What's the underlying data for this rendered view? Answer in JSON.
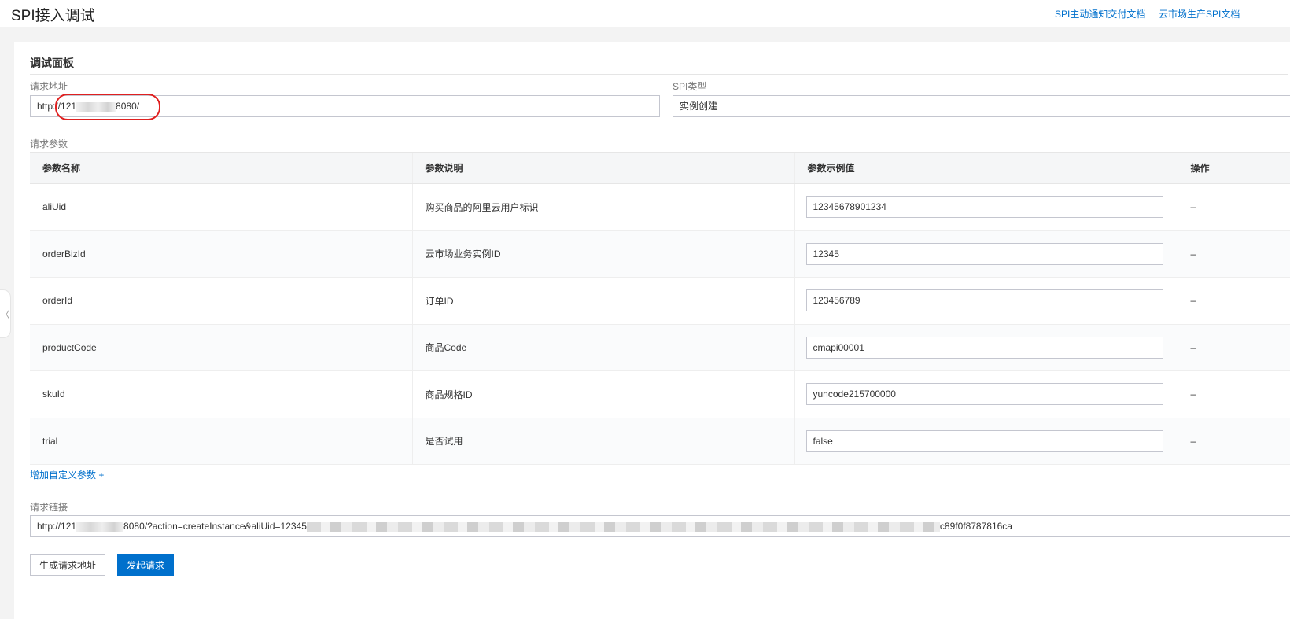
{
  "header": {
    "title": "SPI接入调试",
    "links": [
      "SPI主动通知交付文档",
      "云市场生产SPI文档"
    ]
  },
  "side_handle": {
    "glyph": "〈"
  },
  "panel": {
    "title": "调试面板",
    "request_address": {
      "label": "请求地址",
      "value_prefix": "http://121",
      "value_suffix": "8080/"
    },
    "spi_type": {
      "label": "SPI类型",
      "value": "实例创建"
    },
    "params": {
      "label": "请求参数",
      "columns": [
        "参数名称",
        "参数说明",
        "参数示例值",
        "操作"
      ],
      "rows": [
        {
          "name": "aliUid",
          "desc": "购买商品的阿里云用户标识",
          "value": "12345678901234",
          "action": "–"
        },
        {
          "name": "orderBizId",
          "desc": "云市场业务实例ID",
          "value": "12345",
          "action": "–"
        },
        {
          "name": "orderId",
          "desc": "订单ID",
          "value": "123456789",
          "action": "–"
        },
        {
          "name": "productCode",
          "desc": "商品Code",
          "value": "cmapi00001",
          "action": "–"
        },
        {
          "name": "skuId",
          "desc": "商品规格ID",
          "value": "yuncode215700000",
          "action": "–"
        },
        {
          "name": "trial",
          "desc": "是否试用",
          "value": "false",
          "action": "–"
        }
      ]
    },
    "add_param_label": "增加自定义参数 +",
    "request_link": {
      "label": "请求链接",
      "value_prefix": "http://121",
      "value_middle": "8080/?action=createInstance&aliUid=12345",
      "value_suffix": "c89f0f8787816ca"
    },
    "buttons": {
      "generate": "生成请求地址",
      "send": "发起请求"
    }
  }
}
